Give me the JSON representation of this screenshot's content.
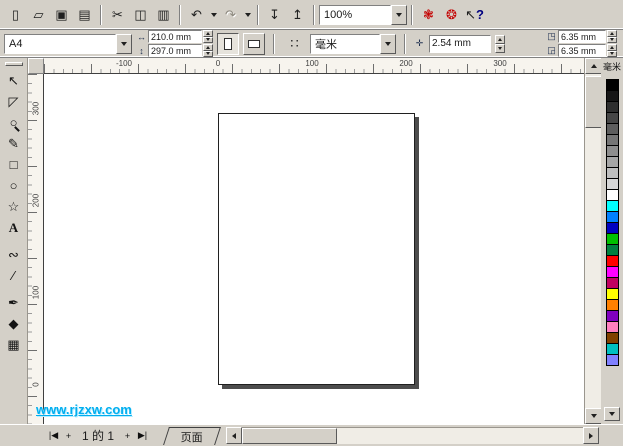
{
  "colors": {
    "chrome": "#d4d0c8",
    "canvas_bg": "#ffffff",
    "page_shadow": "#4d4d4d",
    "watermark": "#00aeef"
  },
  "toolbar": {
    "buttons": [
      {
        "name": "new",
        "glyph": "▯"
      },
      {
        "name": "open",
        "glyph": "▱"
      },
      {
        "name": "save",
        "glyph": "▣"
      },
      {
        "name": "print",
        "glyph": "▤"
      },
      {
        "name": "cut",
        "glyph": "✂"
      },
      {
        "name": "copy",
        "glyph": "◫"
      },
      {
        "name": "paste",
        "glyph": "▥"
      },
      {
        "name": "undo",
        "glyph": "↶"
      },
      {
        "name": "redo",
        "glyph": "↷"
      },
      {
        "name": "import",
        "glyph": "↧"
      },
      {
        "name": "export",
        "glyph": "↥"
      }
    ],
    "zoom_combo": "100%",
    "launcher_glyph": "❃",
    "online_glyph": "❂",
    "help_arrow": "↖",
    "help_glyph": "?"
  },
  "property_bar": {
    "paper_size": "A4",
    "width_icon": "↔",
    "width_value": "210.0 mm",
    "height_icon": "↕",
    "height_value": "297.0 mm",
    "dots_icon": "∷",
    "units_value": "毫米",
    "nudge_icon": "✛",
    "nudge_value": "2.54 mm",
    "dup_y_icon": "◳",
    "dup_y_value": "6.35 mm",
    "dup_x_icon": "◲",
    "dup_x_value": "6.35 mm"
  },
  "toolbox": {
    "tools": [
      {
        "name": "pick",
        "glyph": "↖"
      },
      {
        "name": "shape",
        "glyph": "◸"
      },
      {
        "name": "zoom",
        "glyph": "○"
      },
      {
        "name": "freehand",
        "glyph": "✎"
      },
      {
        "name": "rectangle",
        "glyph": "□"
      },
      {
        "name": "ellipse",
        "glyph": "○"
      },
      {
        "name": "polygon",
        "glyph": "☆"
      },
      {
        "name": "text",
        "glyph": "A"
      },
      {
        "name": "interactive-blend",
        "glyph": "∾"
      },
      {
        "name": "eyedropper",
        "glyph": "∕"
      },
      {
        "name": "outline-pen",
        "glyph": "✒"
      },
      {
        "name": "fill",
        "glyph": "◆"
      },
      {
        "name": "interactive-fill",
        "glyph": "▦"
      }
    ]
  },
  "rulers": {
    "unit": "毫米",
    "h_labels": [
      "-100",
      "0",
      "100",
      "200",
      "300"
    ],
    "v_labels": [
      "300",
      "200",
      "100",
      "0"
    ]
  },
  "palette": {
    "colors": [
      "#000000",
      "#161616",
      "#2e2e2e",
      "#464646",
      "#5e5e5e",
      "#767676",
      "#8e8e8e",
      "#a6a6a6",
      "#bebebe",
      "#d6d6d6",
      "#ffffff",
      "#00ffff",
      "#0080ff",
      "#0000c0",
      "#00c000",
      "#008040",
      "#ff0000",
      "#ff00ff",
      "#c00060",
      "#ffff00",
      "#ff8000",
      "#8000c0",
      "#ff80c0",
      "#804000",
      "#00c0c0",
      "#8080ff"
    ]
  },
  "statusbar": {
    "first_glyph": "|◀",
    "add_before": "+",
    "page_label": "1 的 1",
    "add_after": "+",
    "last_glyph": "▶|",
    "tab_label": "页面"
  },
  "watermark": "www.rjzxw.com"
}
